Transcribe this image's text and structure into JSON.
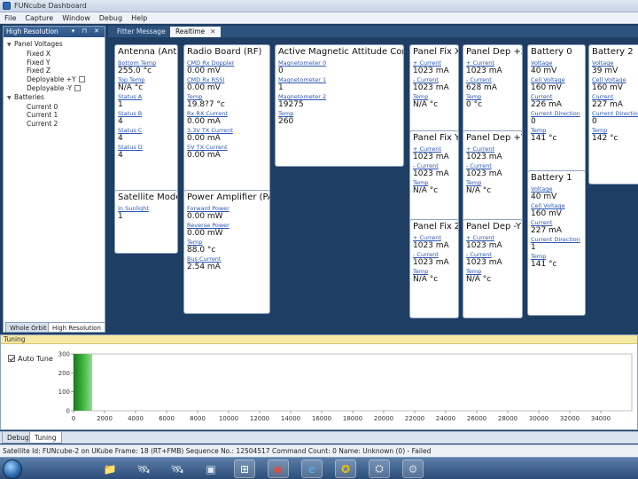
{
  "window": {
    "title": "FUNcube Dashboard"
  },
  "menu": [
    "File",
    "Capture",
    "Window",
    "Debug",
    "Help"
  ],
  "left_panel": {
    "header": "High Resolution",
    "controls": "▾ ⊓ ✕",
    "tree": [
      {
        "label": "Panel Voltages",
        "level": 0,
        "expanded": true
      },
      {
        "label": "Fixed X",
        "level": 1
      },
      {
        "label": "Fixed Y",
        "level": 1
      },
      {
        "label": "Fixed Z",
        "level": 1
      },
      {
        "label": "Deployable +Y",
        "level": 1,
        "checked": true
      },
      {
        "label": "Deployable -Y",
        "level": 1,
        "checked": true
      },
      {
        "label": "Batteries",
        "level": 0,
        "expanded": true
      },
      {
        "label": "Current 0",
        "level": 1
      },
      {
        "label": "Current 1",
        "level": 1
      },
      {
        "label": "Current 2",
        "level": 1
      }
    ],
    "tabs": [
      "Whole Orbit",
      "High Resolution"
    ]
  },
  "doc_tabs": [
    {
      "label": "Fitter Message",
      "active": false
    },
    {
      "label": "Realtime",
      "active": true,
      "close": "✕"
    }
  ],
  "cards": [
    {
      "id": "antenna",
      "title": "Antenna (AntS)",
      "fields": [
        {
          "label": "Bottom Temp",
          "value": "255.0 °c"
        },
        {
          "label": "Top Temp",
          "value": "N/A °c"
        },
        {
          "label": "Status A",
          "value": "1"
        },
        {
          "label": "Status B",
          "value": "4"
        },
        {
          "label": "Status C",
          "value": "4"
        },
        {
          "label": "Status D",
          "value": "4"
        }
      ]
    },
    {
      "id": "radio",
      "title": "Radio Board (RF)",
      "fields": [
        {
          "label": "CMD Rx Doppler",
          "value": "0.00 mV"
        },
        {
          "label": "CMD Rx RSSI",
          "value": "0.00 mV"
        },
        {
          "label": "Temp",
          "value": "19.8?7 °c"
        },
        {
          "label": "Rx RX Current",
          "value": "0.00 mA"
        },
        {
          "label": "3.3V TX Current",
          "value": "0.00 mA"
        },
        {
          "label": "5V TX Current",
          "value": "0.00 mA"
        }
      ]
    },
    {
      "id": "attitude",
      "title": "Active Magnetic Attitude Control",
      "fields": [
        {
          "label": "Magnetometer 0",
          "value": "0"
        },
        {
          "label": "Magnetometer 1",
          "value": "1"
        },
        {
          "label": "Magnetometer 2",
          "value": "19275"
        },
        {
          "label": "Temp",
          "value": "260"
        }
      ]
    },
    {
      "id": "satmode",
      "title": "Satellite Mode",
      "fields": [
        {
          "label": "In Sunlight",
          "value": "1"
        }
      ]
    },
    {
      "id": "pa",
      "title": "Power Amplifier (PA)",
      "fields": [
        {
          "label": "Forward Power",
          "value": "0.00 mW"
        },
        {
          "label": "Reverse Power",
          "value": "0.00 mW"
        },
        {
          "label": "Temp",
          "value": "88.0 °c"
        },
        {
          "label": "Bus Current",
          "value": "2.54 mA"
        }
      ]
    },
    {
      "id": "pfx",
      "title": "Panel Fix X",
      "fields": [
        {
          "label": "+ Current",
          "value": "1023 mA"
        },
        {
          "label": "- Current",
          "value": "1023 mA"
        },
        {
          "label": "Temp",
          "value": "N/A °c"
        }
      ]
    },
    {
      "id": "pdpx",
      "title": "Panel Dep +X",
      "fields": [
        {
          "label": "+ Current",
          "value": "1023 mA"
        },
        {
          "label": "- Current",
          "value": "628 mA"
        },
        {
          "label": "Temp",
          "value": "0 °c"
        }
      ]
    },
    {
      "id": "bat0",
      "title": "Battery 0",
      "fields": [
        {
          "label": "Voltage",
          "value": "40 mV"
        },
        {
          "label": "Cell Voltage",
          "value": "160 mV"
        },
        {
          "label": "Current",
          "value": "226 mA"
        },
        {
          "label": "Current Direction",
          "value": "0"
        },
        {
          "label": "Temp",
          "value": "141 °c"
        }
      ]
    },
    {
      "id": "bat2",
      "title": "Battery 2",
      "fields": [
        {
          "label": "Voltage",
          "value": "39 mV"
        },
        {
          "label": "Cell Voltage",
          "value": "160 mV"
        },
        {
          "label": "Current",
          "value": "227 mA"
        },
        {
          "label": "Current Direction",
          "value": "0"
        },
        {
          "label": "Temp",
          "value": "142 °c"
        }
      ]
    },
    {
      "id": "pfy",
      "title": "Panel Fix Y",
      "fields": [
        {
          "label": "+ Current",
          "value": "1023 mA"
        },
        {
          "label": "- Current",
          "value": "1023 mA"
        },
        {
          "label": "Temp",
          "value": "N/A °c"
        }
      ]
    },
    {
      "id": "pdpy",
      "title": "Panel Dep +Y",
      "fields": [
        {
          "label": "+ Current",
          "value": "1023 mA"
        },
        {
          "label": "- Current",
          "value": "1023 mA"
        },
        {
          "label": "Temp",
          "value": "N/A °c"
        }
      ]
    },
    {
      "id": "bat1",
      "title": "Battery 1",
      "fields": [
        {
          "label": "Voltage",
          "value": "40 mV"
        },
        {
          "label": "Cell Voltage",
          "value": "160 mV"
        },
        {
          "label": "Current",
          "value": "227 mA"
        },
        {
          "label": "Current Direction",
          "value": "1"
        },
        {
          "label": "Temp",
          "value": "141 °c"
        }
      ]
    },
    {
      "id": "pfz",
      "title": "Panel Fix Z",
      "fields": [
        {
          "label": "+ Current",
          "value": "1023 mA"
        },
        {
          "label": "- Current",
          "value": "1023 mA"
        },
        {
          "label": "Temp",
          "value": "N/A °c"
        }
      ]
    },
    {
      "id": "pdmy",
      "title": "Panel Dep -Y",
      "fields": [
        {
          "label": "+ Current",
          "value": "1023 mA"
        },
        {
          "label": "- Current",
          "value": "1023 mA"
        },
        {
          "label": "Temp",
          "value": "N/A °c"
        }
      ]
    }
  ],
  "tuning": {
    "header": "Tuning",
    "auto_tune_label": "Auto Tune",
    "auto_tune_checked": true
  },
  "chart_data": {
    "type": "area",
    "x_ticks": [
      0,
      2000,
      4000,
      6000,
      8000,
      10000,
      12000,
      14000,
      16000,
      18000,
      20000,
      22000,
      24000,
      26000,
      28000,
      30000,
      32000,
      34000
    ],
    "y_ticks": [
      0,
      100,
      200,
      300
    ],
    "xlim": [
      0,
      36000
    ],
    "ylim": [
      0,
      300
    ],
    "x": [
      0,
      100,
      200,
      300,
      400,
      500,
      600,
      700,
      800,
      900,
      1000,
      1100,
      1200
    ],
    "values": [
      300,
      300,
      300,
      300,
      300,
      300,
      300,
      300,
      300,
      300,
      300,
      300,
      300
    ],
    "colors": [
      "#1a7a1a",
      "#3fb33f",
      "#8fdc8f"
    ]
  },
  "bottom_tabs": [
    {
      "label": "Debug",
      "active": false
    },
    {
      "label": "Tuning",
      "active": true
    }
  ],
  "status": "Satellite Id: FUNcube-2 on UKube  Frame: 18 (RT+FMB)  Sequence No.: 12504517  Command Count: 0  Name: Unknown (0) - Failed",
  "taskbar": [
    "start-orb",
    "folder",
    "satellite",
    "satellite-2",
    "terminal",
    "windows",
    "chrome",
    "ie",
    "norton",
    "ukube",
    "funcube"
  ]
}
